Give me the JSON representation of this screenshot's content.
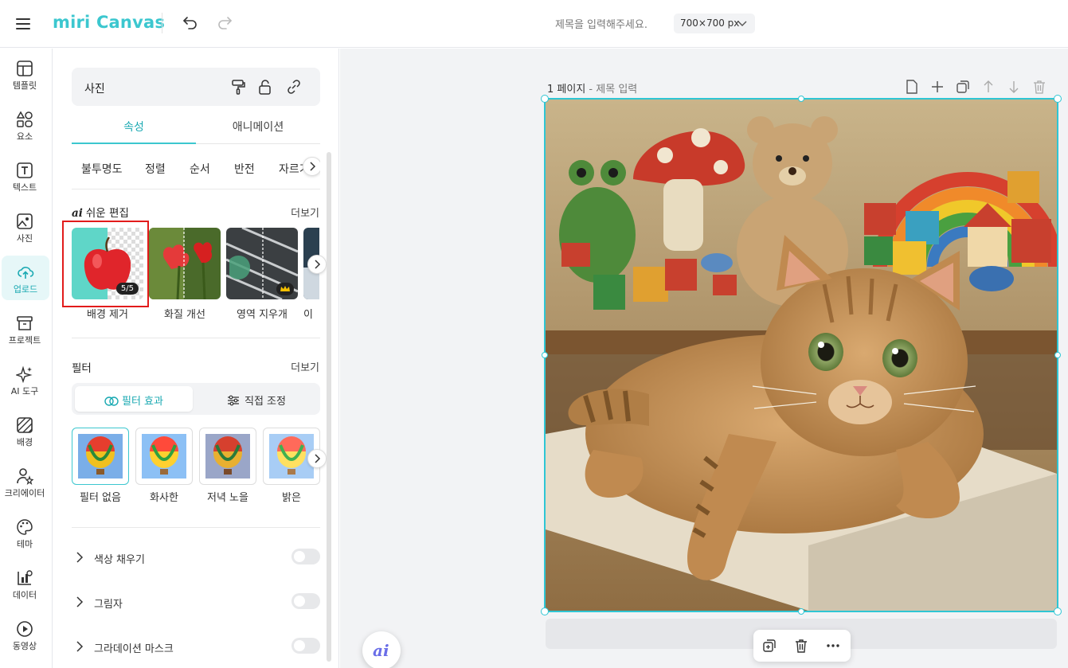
{
  "app": {
    "logo_text": "miri Canvas",
    "brand_color": "#3cc7cf"
  },
  "topbar": {
    "doc_title_placeholder": "제목을 입력해주세요.",
    "canvas_size": "700×700 px"
  },
  "rail": {
    "items": [
      {
        "label": "템플릿",
        "icon": "template-icon"
      },
      {
        "label": "요소",
        "icon": "elements-icon"
      },
      {
        "label": "텍스트",
        "icon": "text-icon"
      },
      {
        "label": "사진",
        "icon": "photo-icon"
      },
      {
        "label": "업로드",
        "icon": "upload-icon",
        "active": true
      },
      {
        "label": "프로젝트",
        "icon": "project-icon"
      },
      {
        "label": "AI 도구",
        "icon": "ai-sparkle-icon"
      },
      {
        "label": "배경",
        "icon": "background-icon"
      },
      {
        "label": "크리에이터",
        "icon": "creator-icon"
      },
      {
        "label": "테마",
        "icon": "theme-palette-icon"
      },
      {
        "label": "데이터",
        "icon": "data-chart-icon"
      },
      {
        "label": "동영상",
        "icon": "video-icon"
      }
    ]
  },
  "panel": {
    "header_title": "사진",
    "tabs": [
      {
        "label": "속성"
      },
      {
        "label": "애니메이션"
      }
    ],
    "subtabs": [
      "불투명도",
      "정렬",
      "순서",
      "반전",
      "자르기"
    ],
    "easy_edit": {
      "title": "쉬운 편집",
      "more": "더보기",
      "items": [
        {
          "label": "배경 제거",
          "badge": "5/5"
        },
        {
          "label": "화질 개선"
        },
        {
          "label": "영역 지우개"
        },
        {
          "label": "이"
        }
      ]
    },
    "filter": {
      "title": "필터",
      "more": "더보기",
      "toggle": {
        "effect": "필터 효과",
        "direct": "직접 조정"
      },
      "items": [
        {
          "label": "필터 없음"
        },
        {
          "label": "화사한"
        },
        {
          "label": "저녁 노을"
        },
        {
          "label": "밝은"
        }
      ]
    },
    "accordions": [
      {
        "label": "색상 채우기"
      },
      {
        "label": "그림자"
      },
      {
        "label": "그라데이션 마스크"
      }
    ]
  },
  "canvas": {
    "page_number": "1 페이지",
    "separator": " - ",
    "page_title_placeholder": "제목 입력"
  }
}
